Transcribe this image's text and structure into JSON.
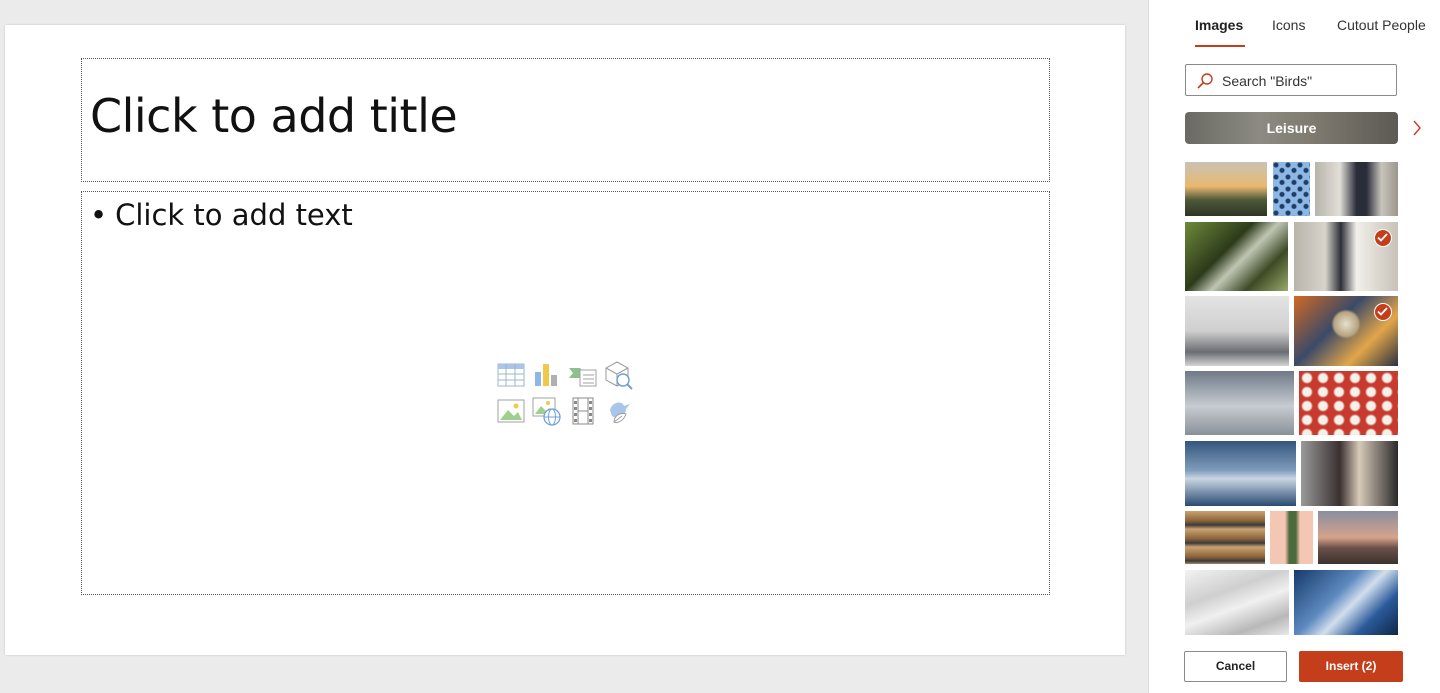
{
  "slide": {
    "title_placeholder": "Click to add title",
    "body_bullet": "•",
    "body_placeholder": "Click to add text",
    "insert_icons": [
      "table-icon",
      "chart-icon",
      "smartart-icon",
      "3d-model-icon",
      "picture-icon",
      "online-picture-icon",
      "video-icon",
      "icons-icon"
    ]
  },
  "panel": {
    "tabs": [
      {
        "label": "Images",
        "active": true
      },
      {
        "label": "Icons",
        "active": false
      },
      {
        "label": "Cutout People",
        "active": false
      }
    ],
    "search_placeholder": "Search \"Birds\"",
    "category_label": "Leisure",
    "images": [
      {
        "name": "image-olive-branch-sunset",
        "selected": false
      },
      {
        "name": "image-blue-bird-pattern",
        "selected": false
      },
      {
        "name": "image-woman-city-street",
        "selected": false
      },
      {
        "name": "image-man-watering-plants",
        "selected": false
      },
      {
        "name": "image-wedding-couple",
        "selected": true
      },
      {
        "name": "image-woman-office-desk",
        "selected": false
      },
      {
        "name": "image-crystal-ball-hand",
        "selected": true
      },
      {
        "name": "image-balance-scale",
        "selected": false
      },
      {
        "name": "image-red-white-umbrellas",
        "selected": false
      },
      {
        "name": "image-icy-landscape",
        "selected": false
      },
      {
        "name": "image-barber-haircut",
        "selected": false
      },
      {
        "name": "image-baguettes",
        "selected": false
      },
      {
        "name": "image-cactus",
        "selected": false
      },
      {
        "name": "image-woman-sunset",
        "selected": false
      },
      {
        "name": "image-book-pages",
        "selected": false
      },
      {
        "name": "image-vaccine-glove",
        "selected": false
      }
    ],
    "cancel_label": "Cancel",
    "insert_label": "Insert (2)"
  },
  "colors": {
    "accent": "#c43e1c",
    "background": "#ebebeb",
    "panel": "#ffffff"
  }
}
